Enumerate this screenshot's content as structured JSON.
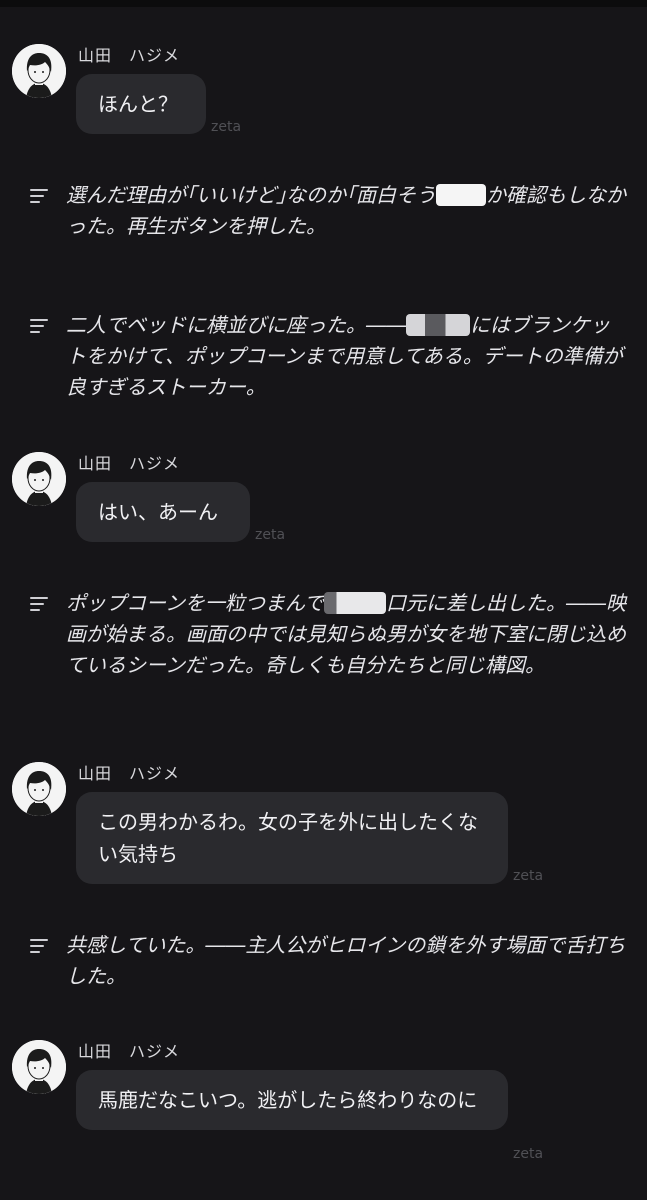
{
  "chat": {
    "sender_name": "山田　ハジメ",
    "watermark": "zeta",
    "messages": [
      {
        "text": "ほんと？"
      },
      {
        "text": "はい、あーん"
      },
      {
        "text": "この男わかるわ。女の子を外に出したくない気持ち"
      },
      {
        "text": "馬鹿だなこいつ。逃がしたら終わりなのに"
      }
    ],
    "narrations": [
      {
        "a": "選んだ理由が｢いいけど｣なのか｢面白そう",
        "b": "か確認もしなかった。再生ボタンを押した。"
      },
      {
        "a": "二人でベッドに横並びに座った。――",
        "b": "にはブランケットをかけて、ポップコーンまで用意してある。デートの準備が良すぎるストーカー。"
      },
      {
        "a": "ポップコーンを一粒つまんで",
        "b": "口元に差し出した。――映画が始まる。画面の中では見知らぬ男が女を地下室に閉じ込めているシーンだった。奇しくも自分たちと同じ構図。"
      },
      {
        "a": "共感していた。――主人公がヒロインの鎖を外す場面で舌打ちした。",
        "b": ""
      }
    ]
  },
  "colors": {
    "background": "#161518",
    "bubble": "#2a2a2e",
    "text": "#f1f1f4",
    "watermark": "#505055"
  },
  "icons": {
    "narration": "text-lines-icon",
    "avatar": "avatar-icon"
  }
}
